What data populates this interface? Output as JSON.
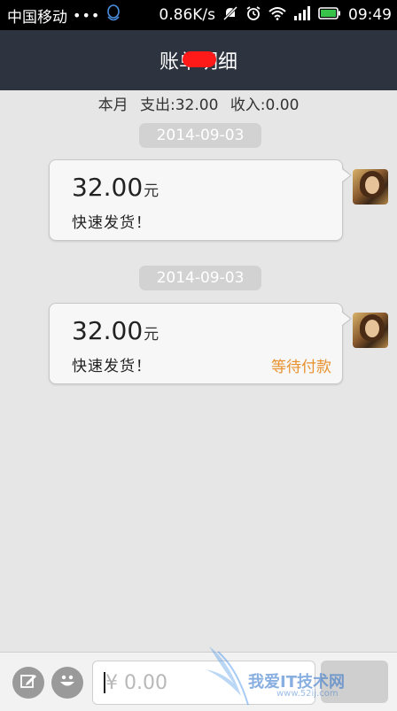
{
  "status_bar": {
    "carrier": "中国移动",
    "dots": "•••",
    "speed": "0.86K/s",
    "time": "09:49",
    "icons": [
      "qq-icon",
      "mute-icon",
      "alarm-icon",
      "wifi-icon",
      "signal-icon",
      "battery-icon"
    ]
  },
  "header": {
    "title": "账单明细"
  },
  "summary": {
    "period": "本月",
    "expense": "支出:32.00",
    "income": "收入:0.00"
  },
  "messages": [
    {
      "date": "2014-09-03",
      "amount": "32.00",
      "unit": "元",
      "note": "快速发货！",
      "status": ""
    },
    {
      "date": "2014-09-03",
      "amount": "32.00",
      "unit": "元",
      "note": "快速发货！",
      "status": "等待付款"
    }
  ],
  "input": {
    "placeholder": "¥ 0.00"
  },
  "watermark": {
    "text": "我爱IT技术网",
    "sub": "www.52ij.com"
  },
  "colors": {
    "header_bg": "#2e343f",
    "status_accent": "#e8912e",
    "background": "#e6e6e6"
  }
}
